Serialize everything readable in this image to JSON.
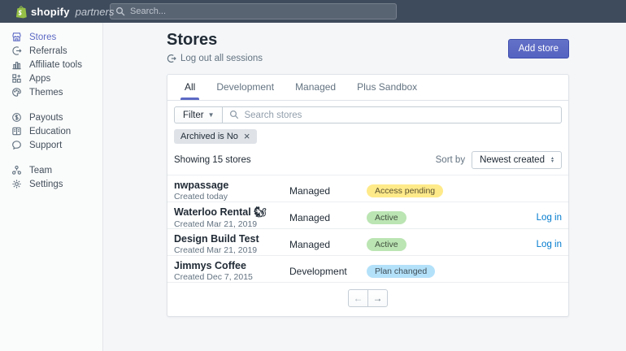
{
  "topbar": {
    "brand_bold": "shopify",
    "brand_light": "partners",
    "search_placeholder": "Search...",
    "brand_green": "#95bf47"
  },
  "sidebar": {
    "items": [
      {
        "label": "Stores",
        "icon": "storefront-icon",
        "active": true
      },
      {
        "label": "Referrals",
        "icon": "referral-arrow-icon",
        "active": false
      },
      {
        "label": "Affiliate tools",
        "icon": "bar-chart-icon",
        "active": false
      },
      {
        "label": "Apps",
        "icon": "apps-grid-icon",
        "active": false
      },
      {
        "label": "Themes",
        "icon": "theme-brush-icon",
        "active": false
      },
      {
        "label": "Payouts",
        "icon": "dollar-circle-icon",
        "active": false
      },
      {
        "label": "Education",
        "icon": "book-icon",
        "active": false
      },
      {
        "label": "Support",
        "icon": "chat-bubble-icon",
        "active": false
      },
      {
        "label": "Team",
        "icon": "team-nodes-icon",
        "active": false
      },
      {
        "label": "Settings",
        "icon": "gear-icon",
        "active": false
      }
    ]
  },
  "header": {
    "title": "Stores",
    "logout_link": "Log out all sessions",
    "add_store_button": "Add store"
  },
  "tabs": [
    {
      "label": "All",
      "active": true
    },
    {
      "label": "Development",
      "active": false
    },
    {
      "label": "Managed",
      "active": false
    },
    {
      "label": "Plus Sandbox",
      "active": false
    }
  ],
  "filters": {
    "filter_button": "Filter",
    "search_placeholder": "Search stores",
    "applied_tag": "Archived is No"
  },
  "list_meta": {
    "showing": "Showing 15 stores",
    "sort_by_label": "Sort by",
    "sort_value": "Newest created"
  },
  "stores": {
    "rows": [
      {
        "name": "nwpassage",
        "created": "Created today",
        "type": "Managed",
        "badge": "Access pending",
        "badge_color": "yellow",
        "login": ""
      },
      {
        "name": "Waterloo Rental 🐿",
        "created": "Created Mar 21, 2019",
        "type": "Managed",
        "badge": "Active",
        "badge_color": "green",
        "login": "Log in"
      },
      {
        "name": "Design Build Test",
        "created": "Created Mar 21, 2019",
        "type": "Managed",
        "badge": "Active",
        "badge_color": "green",
        "login": "Log in"
      },
      {
        "name": "Jimmys Coffee",
        "created": "Created Dec 7, 2015",
        "type": "Development",
        "badge": "Plan changed",
        "badge_color": "blue",
        "login": ""
      }
    ]
  },
  "pagination": {
    "prev": "←",
    "next": "→"
  },
  "colors": {
    "topbar_bg": "#3e4b5c",
    "accent_indigo": "#5c6ac4",
    "link_blue": "#007ace",
    "badge_yellow_bg": "#ffea8a",
    "badge_green_bg": "#bbe5b3",
    "badge_blue_bg": "#b4e1fa",
    "page_bg": "#f4f6f8"
  }
}
